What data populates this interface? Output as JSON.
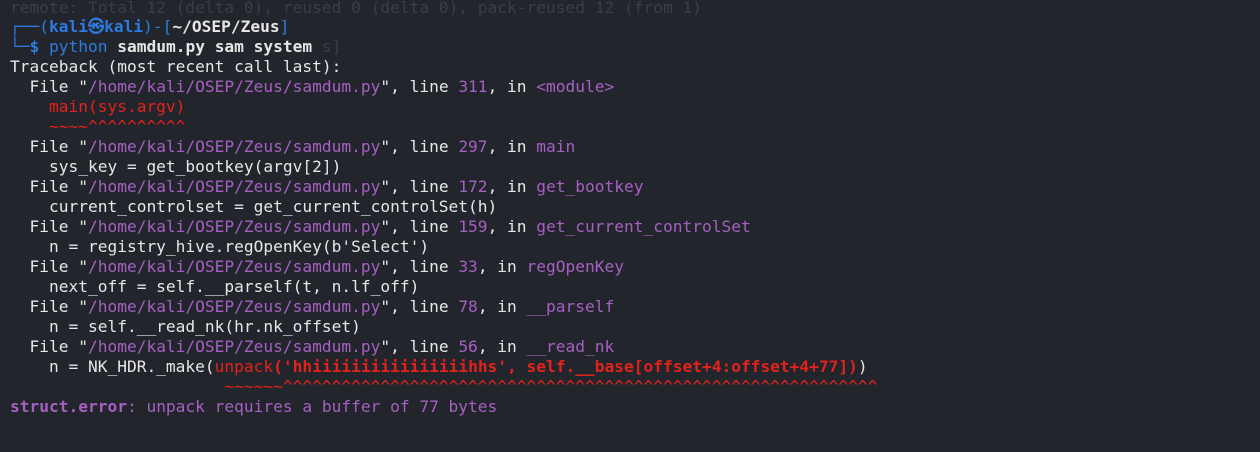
{
  "ghost_line": "remote: Total 12 (delta 0), reused 0 (delta 0), pack-reused 12 (from 1)",
  "prompt": {
    "top_left": "┌──(",
    "user": "kali",
    "skull": "㉿",
    "host": "kali",
    "mid": ")-[",
    "cwd": "~/OSEP/Zeus",
    "end": "]",
    "bottom_left": "└─",
    "dollar": "$",
    "command": "python",
    "args": "samdum.py sam system",
    "ghost_suffix": "s]"
  },
  "traceback": {
    "header": "Traceback (most recent call last):",
    "frames": [
      {
        "file_prefix": "  File \"",
        "path": "/home/kali/OSEP/Zeus/samdum.py",
        "line_word": "\", line ",
        "line_no": "311",
        "in_word": ", in ",
        "func": "<module>",
        "code_plain_prefix": "    ",
        "code": "main(sys.argv)",
        "marker": "~~~~^^^^^^^^^^"
      },
      {
        "file_prefix": "  File \"",
        "path": "/home/kali/OSEP/Zeus/samdum.py",
        "line_word": "\", line ",
        "line_no": "297",
        "in_word": ", in ",
        "func": "main",
        "code": "    sys_key = get_bootkey(argv[2])"
      },
      {
        "file_prefix": "  File \"",
        "path": "/home/kali/OSEP/Zeus/samdum.py",
        "line_word": "\", line ",
        "line_no": "172",
        "in_word": ", in ",
        "func": "get_bootkey",
        "code": "    current_controlset = get_current_controlSet(h)"
      },
      {
        "file_prefix": "  File \"",
        "path": "/home/kali/OSEP/Zeus/samdum.py",
        "line_word": "\", line ",
        "line_no": "159",
        "in_word": ", in ",
        "func": "get_current_controlSet",
        "code": "    n = registry_hive.regOpenKey(b'Select')"
      },
      {
        "file_prefix": "  File \"",
        "path": "/home/kali/OSEP/Zeus/samdum.py",
        "line_word": "\", line ",
        "line_no": "33",
        "in_word": ", in ",
        "func": "regOpenKey",
        "code": "    next_off = self.__parself(t, n.lf_off)"
      },
      {
        "file_prefix": "  File \"",
        "path": "/home/kali/OSEP/Zeus/samdum.py",
        "line_word": "\", line ",
        "line_no": "78",
        "in_word": ", in ",
        "func": "__parself",
        "code": "    n = self.__read_nk(hr.nk_offset)"
      },
      {
        "file_prefix": "  File \"",
        "path": "/home/kali/OSEP/Zeus/samdum.py",
        "line_word": "\", line ",
        "line_no": "56",
        "in_word": ", in ",
        "func": "__read_nk",
        "code_prefix": "    n = NK_HDR._make(",
        "code_err_func": "unpack",
        "code_err_args": "('hhiiiiiiiiiiiiiiiihhs', self.__base[offset+4:offset+4+77])",
        "code_suffix": ")",
        "marker_pad": "                      ",
        "marker_tildes": "~~~~~~",
        "marker_carets": "^^^^^^^^^^^^^^^^^^^^^^^^^^^^^^^^^^^^^^^^^^^^^^^^^^^^^^^^^^^^^"
      }
    ],
    "exception_type": "struct.error",
    "exception_msg": ": unpack requires a buffer of 77 bytes"
  },
  "colors": {
    "background": "#22252b",
    "prompt_blue": "#2d7be0",
    "path_purple": "#a660c2",
    "error_red": "#e3221b",
    "text": "#e6e6e6"
  }
}
